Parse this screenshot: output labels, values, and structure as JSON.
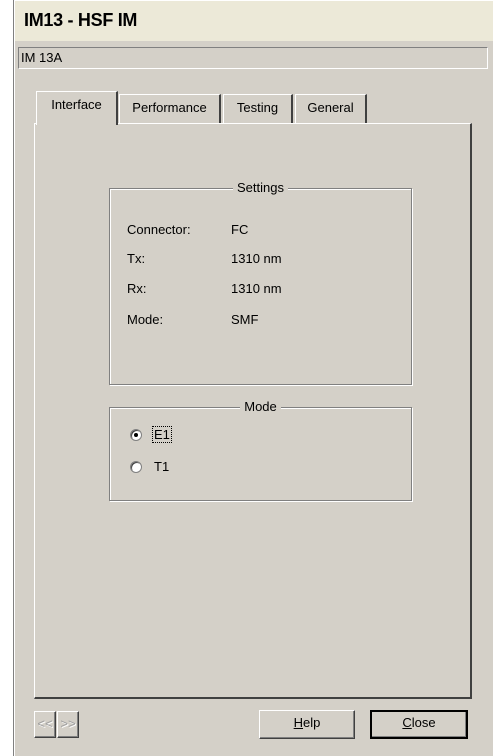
{
  "window": {
    "title": "IM13 - HSF IM",
    "subtitle": "IM 13A"
  },
  "tabs": [
    {
      "label": "Interface",
      "active": true
    },
    {
      "label": "Performance",
      "active": false
    },
    {
      "label": "Testing",
      "active": false
    },
    {
      "label": "General",
      "active": false
    }
  ],
  "settings": {
    "title": "Settings",
    "connector_label": "Connector:",
    "connector_value": "FC",
    "tx_label": "Tx:",
    "tx_value": "1310 nm",
    "rx_label": "Rx:",
    "rx_value": "1310 nm",
    "mode_label": "Mode:",
    "mode_value": "SMF"
  },
  "mode": {
    "title": "Mode",
    "options": [
      {
        "label": "E1",
        "selected": true
      },
      {
        "label": "T1",
        "selected": false
      }
    ]
  },
  "buttons": {
    "prev_label": "<<",
    "next_label": ">>",
    "help_label_first": "H",
    "help_label_rest": "elp",
    "close_label_first": "C",
    "close_label_rest": "lose"
  }
}
